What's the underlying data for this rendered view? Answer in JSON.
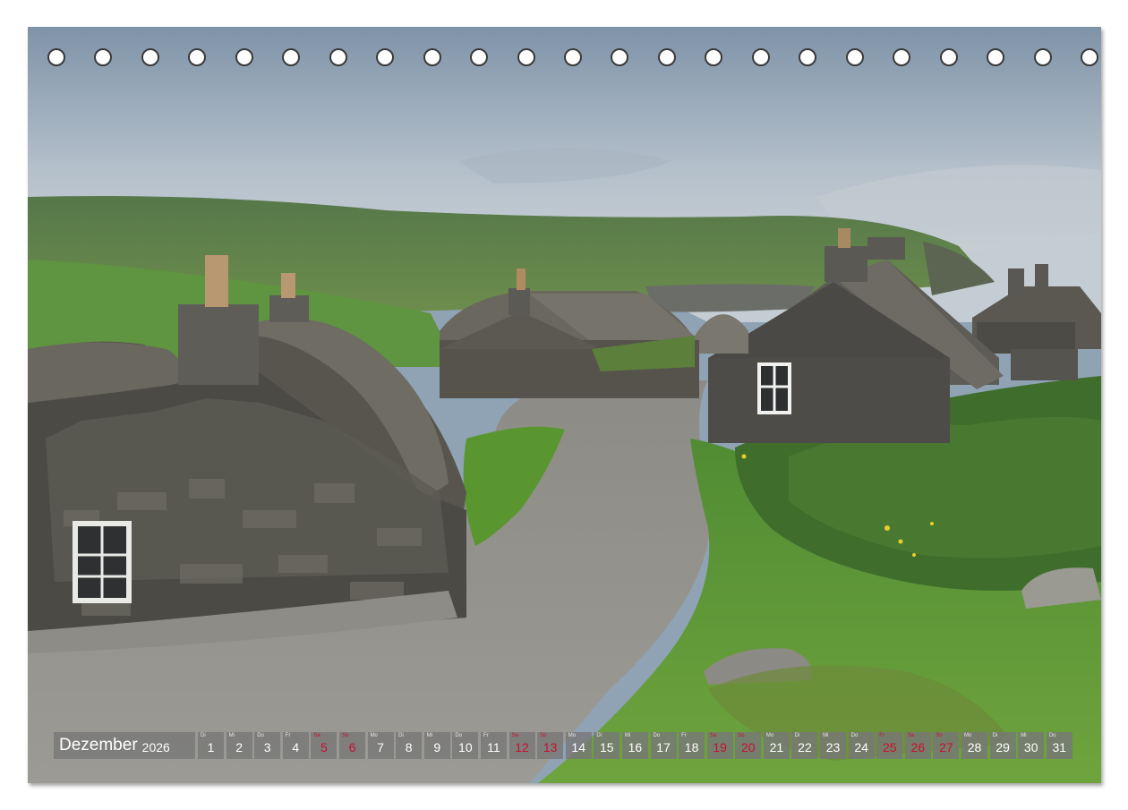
{
  "calendar": {
    "month": "Dezember",
    "year": "2026",
    "days": [
      {
        "n": "1",
        "wd": "Di",
        "we": false
      },
      {
        "n": "2",
        "wd": "Mi",
        "we": false
      },
      {
        "n": "3",
        "wd": "Do",
        "we": false
      },
      {
        "n": "4",
        "wd": "Fr",
        "we": false
      },
      {
        "n": "5",
        "wd": "Sa",
        "we": true
      },
      {
        "n": "6",
        "wd": "So",
        "we": true
      },
      {
        "n": "7",
        "wd": "Mo",
        "we": false
      },
      {
        "n": "8",
        "wd": "Di",
        "we": false
      },
      {
        "n": "9",
        "wd": "Mi",
        "we": false
      },
      {
        "n": "10",
        "wd": "Do",
        "we": false
      },
      {
        "n": "11",
        "wd": "Fr",
        "we": false
      },
      {
        "n": "12",
        "wd": "Sa",
        "we": true
      },
      {
        "n": "13",
        "wd": "So",
        "we": true
      },
      {
        "n": "14",
        "wd": "Mo",
        "we": false
      },
      {
        "n": "15",
        "wd": "Di",
        "we": false
      },
      {
        "n": "16",
        "wd": "Mi",
        "we": false
      },
      {
        "n": "17",
        "wd": "Do",
        "we": false
      },
      {
        "n": "18",
        "wd": "Fr",
        "we": false
      },
      {
        "n": "19",
        "wd": "Sa",
        "we": true
      },
      {
        "n": "20",
        "wd": "So",
        "we": true
      },
      {
        "n": "21",
        "wd": "Mo",
        "we": false
      },
      {
        "n": "22",
        "wd": "Di",
        "we": false
      },
      {
        "n": "23",
        "wd": "Mi",
        "we": false
      },
      {
        "n": "24",
        "wd": "Do",
        "we": false
      },
      {
        "n": "25",
        "wd": "Fr",
        "we": true
      },
      {
        "n": "26",
        "wd": "Sa",
        "we": true
      },
      {
        "n": "27",
        "wd": "So",
        "we": true
      },
      {
        "n": "28",
        "wd": "Mo",
        "we": false
      },
      {
        "n": "29",
        "wd": "Di",
        "we": false
      },
      {
        "n": "30",
        "wd": "Mi",
        "we": false
      },
      {
        "n": "31",
        "wd": "Do",
        "we": false
      }
    ],
    "holiday_color": "#c8102e"
  },
  "binding": {
    "hole_count": 23
  }
}
